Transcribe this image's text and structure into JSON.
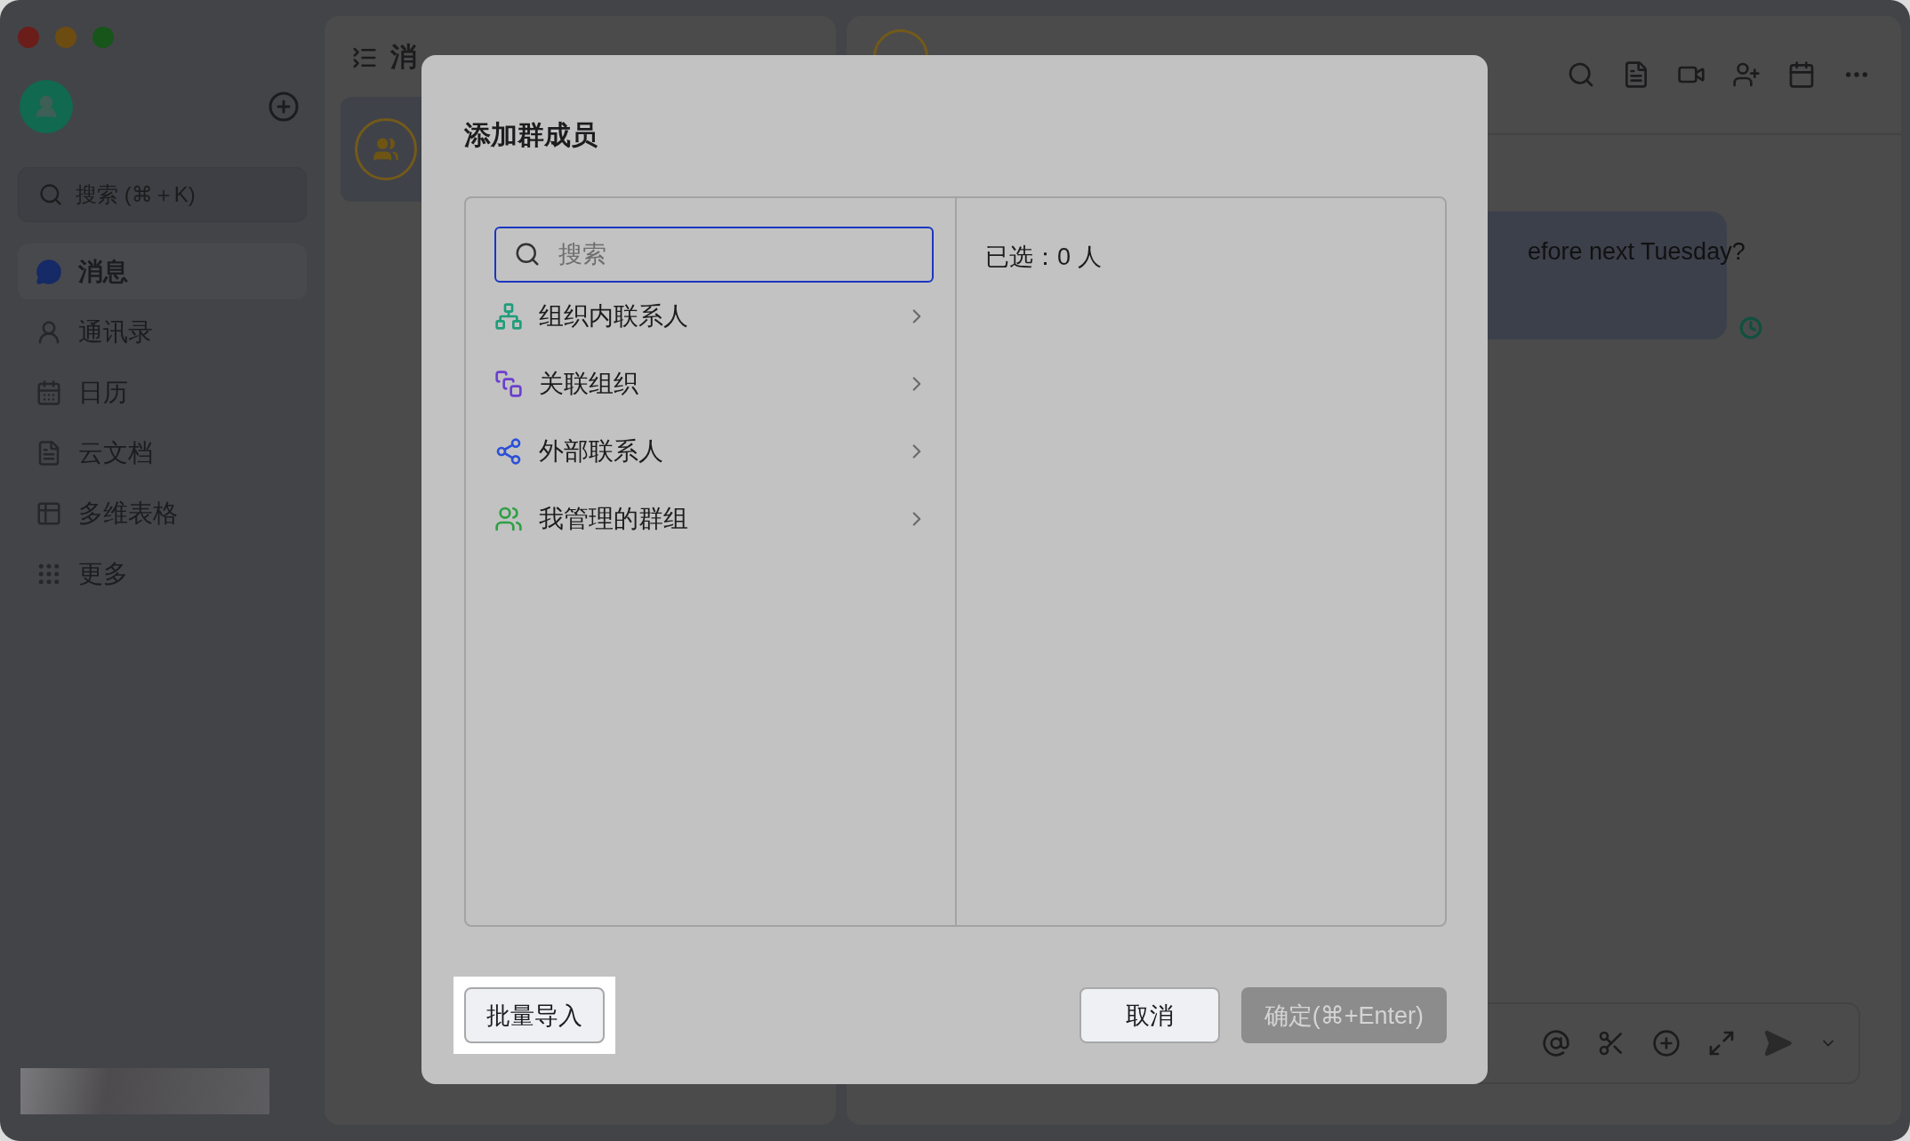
{
  "sidebar": {
    "search": {
      "placeholder": "搜索 (⌘＋K)"
    },
    "items": [
      {
        "label": "消息",
        "selected": true
      },
      {
        "label": "通讯录",
        "selected": false
      },
      {
        "label": "日历",
        "selected": false
      },
      {
        "label": "云文档",
        "selected": false
      },
      {
        "label": "多维表格",
        "selected": false
      },
      {
        "label": "更多",
        "selected": false
      }
    ]
  },
  "chat_list": {
    "title": "消"
  },
  "chat": {
    "message": "efore next Tuesday?"
  },
  "dialog": {
    "title": "添加群成员",
    "search": {
      "placeholder": "搜索"
    },
    "sources": [
      {
        "label": "组织内联系人",
        "color": "#1f9d7a"
      },
      {
        "label": "关联组织",
        "color": "#6b3fd0"
      },
      {
        "label": "外部联系人",
        "color": "#2c50d8"
      },
      {
        "label": "我管理的群组",
        "color": "#2ea043"
      }
    ],
    "selected_summary": "已选：0 人",
    "buttons": [
      {
        "label": "批量导入",
        "kind": "secondary",
        "highlighted": true,
        "disabled": false
      },
      {
        "label": "取消",
        "kind": "secondary",
        "highlighted": false,
        "disabled": false
      },
      {
        "label": "确定(⌘+Enter)",
        "kind": "primary",
        "highlighted": false,
        "disabled": true
      }
    ]
  }
}
